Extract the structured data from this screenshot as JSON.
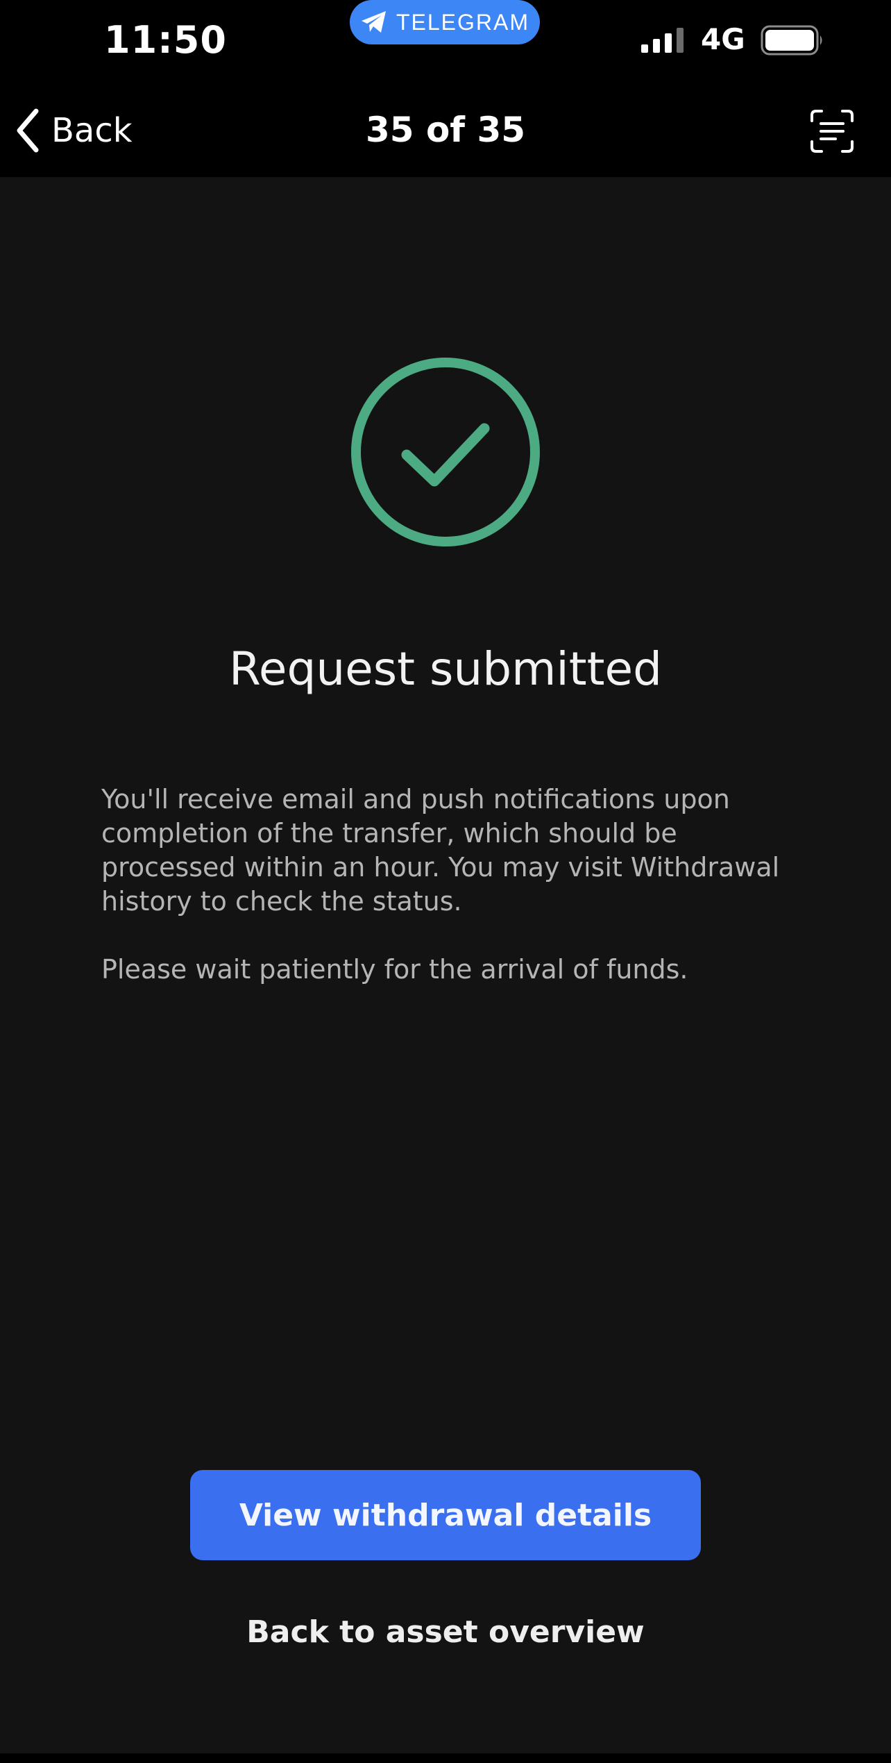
{
  "status_bar": {
    "time": "11:50",
    "telegram_label": "TELEGRAM",
    "network": "4G",
    "icons": [
      "telegram-plane-icon",
      "signal-bars-icon",
      "battery-icon"
    ],
    "battery_level": 1.0
  },
  "nav": {
    "back_label": "Back",
    "title": "35 of 35",
    "icons": [
      "chevron-left-icon",
      "scan-text-icon"
    ]
  },
  "content": {
    "success_icon": "check-circle-icon",
    "headline": "Request submitted",
    "body_lines": [
      "You'll receive email and push notifications upon",
      "completion of the transfer, which should be",
      "processed within an hour. You may visit Withdrawal",
      "history to check the status."
    ],
    "note": "Please wait patiently for the arrival of funds.",
    "primary_button": "View withdrawal details",
    "secondary_link": "Back to asset overview"
  },
  "colors": {
    "accent_green": "#4cab82",
    "button_blue": "#3a6ff0",
    "telegram_blue": "#3d86f6",
    "background": "#131313"
  }
}
